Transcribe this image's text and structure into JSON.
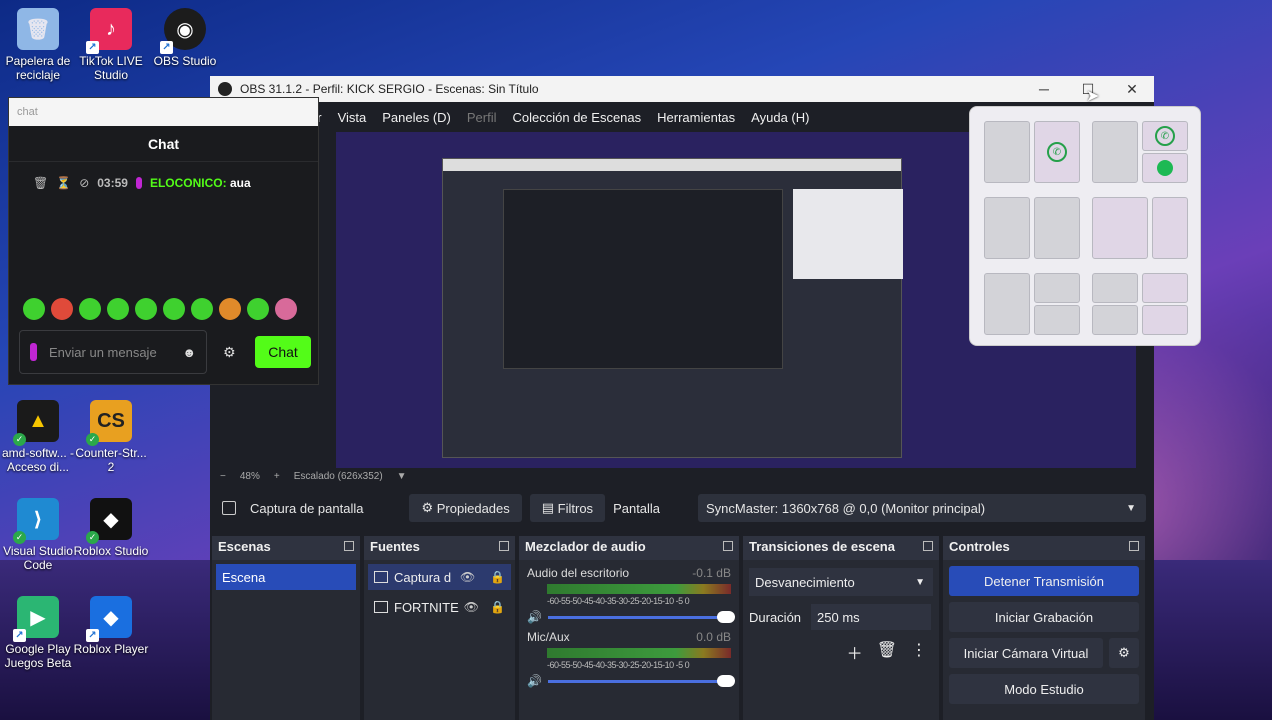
{
  "desktop": {
    "icons": [
      {
        "label": "Papelera de reciclaje",
        "icon": "recycle-bin-icon"
      },
      {
        "label": "TikTok LIVE Studio",
        "icon": "tiktok-icon"
      },
      {
        "label": "OBS Studio",
        "icon": "obs-icon"
      },
      {
        "label": "amd-softw... - Acceso di...",
        "icon": "amd-icon"
      },
      {
        "label": "Counter-Str... 2",
        "icon": "counter-strike-icon"
      },
      {
        "label": "Visual Studio Code",
        "icon": "vscode-icon"
      },
      {
        "label": "Roblox Studio",
        "icon": "roblox-studio-icon"
      },
      {
        "label": "Google Play Juegos Beta",
        "icon": "google-play-games-icon"
      },
      {
        "label": "Roblox Player",
        "icon": "roblox-player-icon"
      }
    ]
  },
  "obs": {
    "title": "OBS 31.1.2 - Perfil: KICK SERGIO - Escenas: Sin Título",
    "menu": [
      "ar",
      "Vista",
      "Paneles (D)",
      "Perfil",
      "Colección de Escenas",
      "Herramientas",
      "Ayuda (H)"
    ],
    "zoom": "48%",
    "scaling": "Escalado (626x352)",
    "source_bar": {
      "source_name": "Captura de pantalla",
      "properties": "Propiedades",
      "filters": "Filtros",
      "screen_label": "Pantalla",
      "monitor": "SyncMaster: 1360x768 @ 0,0 (Monitor principal)"
    },
    "docks": {
      "scenes": {
        "title": "Escenas",
        "items": [
          "Escena"
        ]
      },
      "sources": {
        "title": "Fuentes",
        "items": [
          "Captura d",
          "FORTNITE"
        ]
      },
      "mixer": {
        "title": "Mezclador de audio",
        "channels": [
          {
            "name": "Audio del escritorio",
            "db": "-0.1 dB"
          },
          {
            "name": "Mic/Aux",
            "db": "0.0 dB"
          }
        ],
        "ticks": "-60-55-50-45-40-35-30-25-20-15-10 -5  0"
      },
      "transitions": {
        "title": "Transiciones de escena",
        "selected": "Desvanecimiento",
        "duration_label": "Duración",
        "duration": "250 ms"
      },
      "controls": {
        "title": "Controles",
        "stop_stream": "Detener Transmisión",
        "start_record": "Iniciar Grabación",
        "virtual_cam": "Iniciar Cámara Virtual",
        "studio_mode": "Modo Estudio"
      }
    }
  },
  "chat": {
    "search_placeholder": "chat",
    "title": "Chat",
    "messages": [
      {
        "time": "03:59",
        "user": "ELOCONICO:",
        "text": "aua"
      }
    ],
    "input_placeholder": "Enviar un mensaje",
    "send": "Chat",
    "emote_count": 10
  },
  "colors": {
    "accent_blue": "#284cb8",
    "kick_green": "#53fc18"
  }
}
